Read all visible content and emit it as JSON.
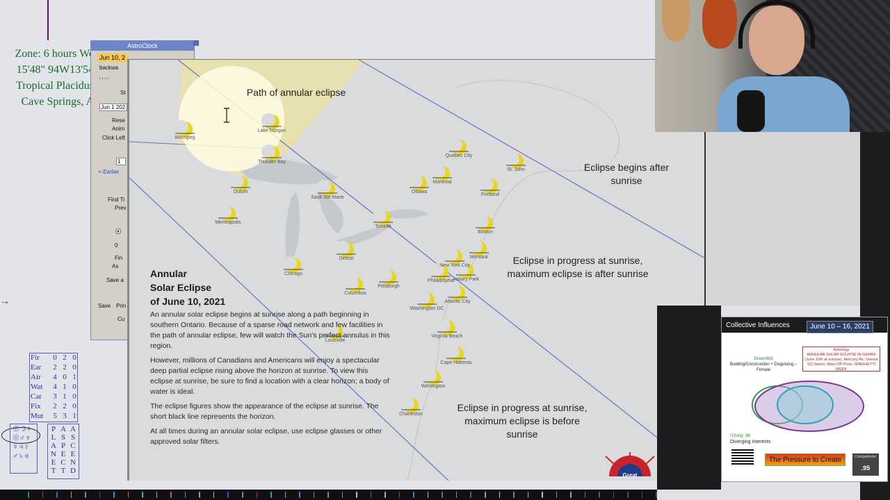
{
  "astro": {
    "info_lines": [
      "Zone: 6 hours We",
      "15'48\"  94W13'54",
      "Tropical Placidus",
      "Cave Springs, A"
    ],
    "elements": [
      {
        "label": "Fir",
        "v": [
          "0",
          "2",
          "0"
        ]
      },
      {
        "label": "Ear",
        "v": [
          "2",
          "2",
          "0"
        ]
      },
      {
        "label": "Air",
        "v": [
          "4",
          "0",
          "1"
        ]
      },
      {
        "label": "Wat",
        "v": [
          "4",
          "1",
          "0"
        ]
      },
      {
        "label": "Car",
        "v": [
          "3",
          "1",
          "0"
        ]
      },
      {
        "label": "Fix",
        "v": [
          "2",
          "2",
          "0"
        ]
      },
      {
        "label": "Mut",
        "v": [
          "5",
          "3",
          "1"
        ]
      }
    ],
    "col_planet": "PLANET",
    "col_aspect": "ASPECT",
    "col_ascend": "ASCEND",
    "glyph_rows": [
      "☉☽♀",
      "☉♂♆",
      "☿♃♇",
      "♂♄♅"
    ]
  },
  "clock": {
    "title": "AstroClock",
    "date": "Jun 10, 2",
    "backward": "backwa",
    "dots": "' ' ' '",
    "st": "St",
    "date_field": "Jun 1 202",
    "reset": "Rese",
    "animate": "Anim",
    "click_left": "Click Left",
    "step_value": "1",
    "earlier": "<-Earlier",
    "find": "Find Ti",
    "prev": "Prev",
    "zero": "0",
    "find_btn": "Fin",
    "as": "As",
    "save_a": "Save a",
    "save": "Save",
    "print": "Prin",
    "cut": "Cu"
  },
  "map": {
    "path_label": "Path of annular eclipse",
    "begins_after": "Eclipse begins after sunrise",
    "progress_after": [
      "Eclipse in progress at sunrise,",
      "maximum eclipse is after sunrise"
    ],
    "progress_before": [
      "Eclipse in progress at sunrise,",
      "maximum eclipse is before sunrise"
    ],
    "title": [
      "Annular",
      "Solar Eclipse",
      "of June 10, 2021"
    ],
    "body": [
      "An annular solar eclipse begins at sunrise along a path beginning in southern Ontario. Because of a sparse road network and few facilities in the path of annular eclipse, few will watch the Sun's perfect annulus in this region.",
      "However, millions of Canadians and Americans will enjoy a spectacular deep partial eclipse rising above the horizon at sunrise. To view this eclipse at sunrise, be sure to find a location with a clear horizon; a body of water is ideal.",
      "The eclipse figures show the appearance of the eclipse at sunrise. The short black line represents the horizon.",
      "At all times during an annular solar eclipse, use eclipse glasses or other approved solar filters."
    ],
    "cities": [
      "Winnipeg",
      "Lake Nipigon",
      "Thunder Bay",
      "Duluth",
      "Minneapolis",
      "Sault Ste Marie",
      "Toronto",
      "Detroit",
      "Chicago",
      "Columbus",
      "Pittsburgh",
      "Louisville",
      "Ottawa",
      "Montreal",
      "Quebec City",
      "St. John",
      "Portland",
      "Boston",
      "Montauk",
      "New York City",
      "Philadelphia",
      "Asbury Park",
      "Atlantic City",
      "Washington DC",
      "Virginia Beach",
      "Cape Hatteras",
      "Wilmington",
      "Charleston"
    ],
    "logo_text": "Great"
  },
  "ci": {
    "title": "Collective Influences",
    "date_range": "June 10 – 16, 2021",
    "dreambot_name": "DreamBot",
    "dreambot_text": "Building/Construction + Disguising – Female",
    "astro_head": "Astrology",
    "astro_text": "ANNULAR SOLAR ECLIPSE IN GEMINI (June 10th at sunrise), Mercury Rx, Uranus SQ Saturn, Mars OP Pluto, SPAGHETTI WEEK",
    "iching_head": "I'Ching: 38",
    "iching_text": "Diverging Interests",
    "pressure": "The Pressure to Create",
    "compat_head": "Compatimeter",
    "compat_value": ".95"
  },
  "colors": {
    "eclipse_yellow": "#e9d51a",
    "path_fill": "#e7e2b0",
    "ci_header": "#1c1c1e"
  }
}
